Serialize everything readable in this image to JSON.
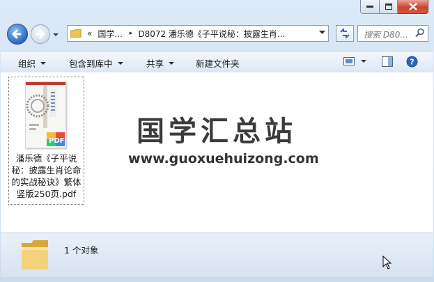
{
  "window": {
    "caption_buttons": {
      "minimize": "minimize",
      "maximize": "maximize",
      "close": "close"
    }
  },
  "nav": {
    "breadcrumb_overflow": "«",
    "breadcrumb_1": "国学...",
    "breadcrumb_sep": "▸",
    "breadcrumb_2": "D8072 潘乐德《子平说秘：披露生肖...",
    "search_placeholder": "搜索 D80..."
  },
  "toolbar": {
    "organize": "组织",
    "include_library": "包含到库中",
    "share": "共享",
    "new_folder": "新建文件夹"
  },
  "file": {
    "name_line1": "潘乐德《子平说",
    "name_line2": "秘：披露生肖论命",
    "name_line3": "的实战秘诀》繁体",
    "name_line4": "竖版250页.pdf",
    "badge": "PDF"
  },
  "watermark": {
    "title": "国学汇总站",
    "url": "www.guoxuehuizong.com"
  },
  "details": {
    "count": "1 个对象"
  },
  "colors": {
    "accent": "#2f6fc4",
    "close": "#c9462f"
  }
}
